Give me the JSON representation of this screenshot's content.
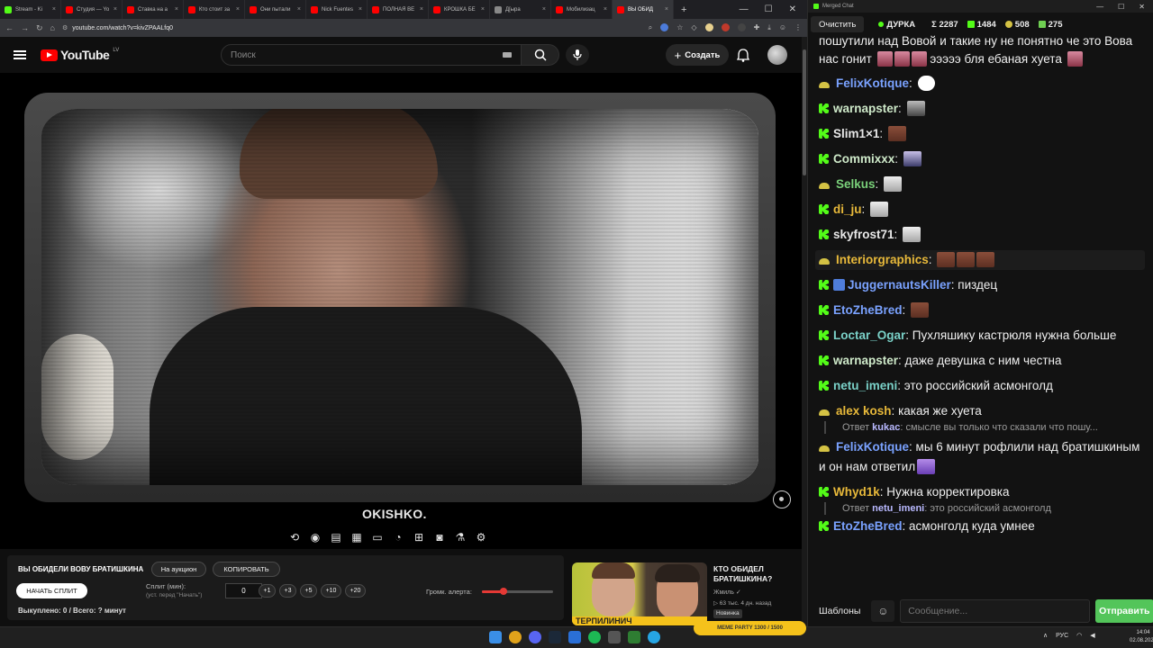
{
  "browser": {
    "tabs": [
      {
        "label": "Stream - Ki",
        "color": "#53fc18"
      },
      {
        "label": "Студия — Yo",
        "color": "#ff0000"
      },
      {
        "label": "Ставка на а",
        "color": "#ff0000"
      },
      {
        "label": "Кто стоит за",
        "color": "#ff0000"
      },
      {
        "label": "Они пытали",
        "color": "#ff0000"
      },
      {
        "label": "Nick Fuentes",
        "color": "#ff0000"
      },
      {
        "label": "ПОЛНАЯ ВЕ",
        "color": "#ff0000"
      },
      {
        "label": "КРОШКА БЕ",
        "color": "#ff0000"
      },
      {
        "label": "Д[ыра",
        "color": "#888888"
      },
      {
        "label": "Мобилизац",
        "color": "#ff0000"
      },
      {
        "label": "ВЫ ОБИД",
        "color": "#ff0000",
        "active": true
      }
    ],
    "url": "youtube.com/watch?v=kivZPAALfq0"
  },
  "youtube": {
    "logo_text": "YouTube",
    "country_code": "LV",
    "search_placeholder": "Поиск",
    "create_label": "Создать"
  },
  "video": {
    "watermark": "OKISHKO."
  },
  "extension_toolbar": {
    "icons": [
      "repeat-icon",
      "broadcast-icon",
      "subtitles-icon",
      "clapper-icon",
      "crop-icon",
      "speed-icon",
      "add-icon",
      "camera-icon",
      "flask-icon",
      "gear-icon"
    ]
  },
  "auction": {
    "title": "ВЫ ОБИДЕЛИ ВОВУ БРАТИШКИНА",
    "on_auction_label": "На аукцион",
    "copy_label": "КОПИРОВАТЬ",
    "start_split_label": "НАЧАТЬ СПЛИТ",
    "split_label": "Сплит (мин):",
    "split_hint": "(уст. перед \"Начать\")",
    "split_value": "0",
    "increments": [
      "+1",
      "+3",
      "+5",
      "+10",
      "+20"
    ],
    "alert_volume_label": "Громк. алерта:",
    "alert_volume_fraction": 0.3,
    "status": "Выкуплено: 0 / Всего: ? минут"
  },
  "recommended": {
    "title": "КТО ОБИДЕЛ БРАТИШКИНА?",
    "channel": "Жмиль",
    "meta": "▷ 63 тыс.  4 дн. назад",
    "badge": "Новинка",
    "banner_text": "ТЕРПИЛИНИЧ"
  },
  "chat": {
    "window_title": "Merged Chat",
    "clear_label": "Очистить",
    "stream_name": "ДУРКА",
    "stats": {
      "total": "Σ 2287",
      "kick": "1484",
      "twitch": "508",
      "other": "275"
    },
    "colors": {
      "kick": "#53fc18",
      "twitch": "#d4c244",
      "other": "#6fcf52"
    },
    "messages": [
      {
        "text": "пошутили над Вовой  и такие ну не понятно  че это Вова нас гонит",
        "tail": "эээээ бля ебаная  хуета"
      },
      {
        "platform": "twitch",
        "user": "FelixKotique",
        "color": "#7aa2ff",
        "text": ""
      },
      {
        "platform": "kick",
        "user": "warnapster",
        "color": "#cde8c8",
        "text": ""
      },
      {
        "platform": "kick",
        "user": "Slim1×1",
        "color": "#e8e8e8",
        "text": ""
      },
      {
        "platform": "kick",
        "user": "Commixxx",
        "color": "#cde8c8",
        "text": ""
      },
      {
        "platform": "twitch",
        "user": "Selkus",
        "color": "#7ad17a",
        "text": ""
      },
      {
        "platform": "kick",
        "user": "di_ju",
        "color": "#e8b93a",
        "text": ""
      },
      {
        "platform": "kick",
        "user": "skyfrost71",
        "color": "#e8e8e8",
        "text": ""
      },
      {
        "platform": "twitch",
        "user": "Interiorgraphics",
        "color": "#e8b93a",
        "text": ""
      },
      {
        "platform": "kick",
        "user": "JuggernautsKiller",
        "color": "#7aa2ff",
        "text": "пиздец"
      },
      {
        "platform": "kick",
        "user": "EtoZheBred",
        "color": "#7aa2ff",
        "text": ""
      },
      {
        "platform": "kick",
        "user": "Loctar_Ogar",
        "color": "#7ad1c8",
        "text": "Пухляшику кастрюля нужна больше"
      },
      {
        "platform": "kick",
        "user": "warnapster",
        "color": "#cde8c8",
        "text": "даже девушка с ним честна"
      },
      {
        "platform": "kick",
        "user": "netu_imeni",
        "color": "#7ad1c8",
        "text": "это российский асмонголд"
      },
      {
        "platform": "twitch",
        "user": "alex kosh",
        "color": "#e8b93a",
        "text": "какая же хуета",
        "reply_user": "kukac",
        "reply_text": "смысле вы только что сказали что пошу..."
      },
      {
        "platform": "twitch",
        "user": "FelixKotique",
        "color": "#7aa2ff",
        "text": "мы 6 минут рофлили над братишкиным и он нам ответил"
      },
      {
        "platform": "kick",
        "user": "Whyd1k",
        "color": "#e8b93a",
        "text": "Нужна корректировка",
        "reply_user": "netu_imeni",
        "reply_text": "это российский асмонголд"
      },
      {
        "platform": "kick",
        "user": "EtoZheBred",
        "color": "#7aa2ff",
        "text": "асмонголд куда умнее"
      }
    ],
    "reply_prefix": "Ответ",
    "templates_label": "Шаблоны",
    "input_placeholder": "Сообщение...",
    "send_label": "Отправить"
  },
  "taskbar": {
    "kick_widget": "MEME PARTY  1300 / 1500",
    "lang": "РУС",
    "time": "14:04",
    "date": "02.08.2026"
  }
}
